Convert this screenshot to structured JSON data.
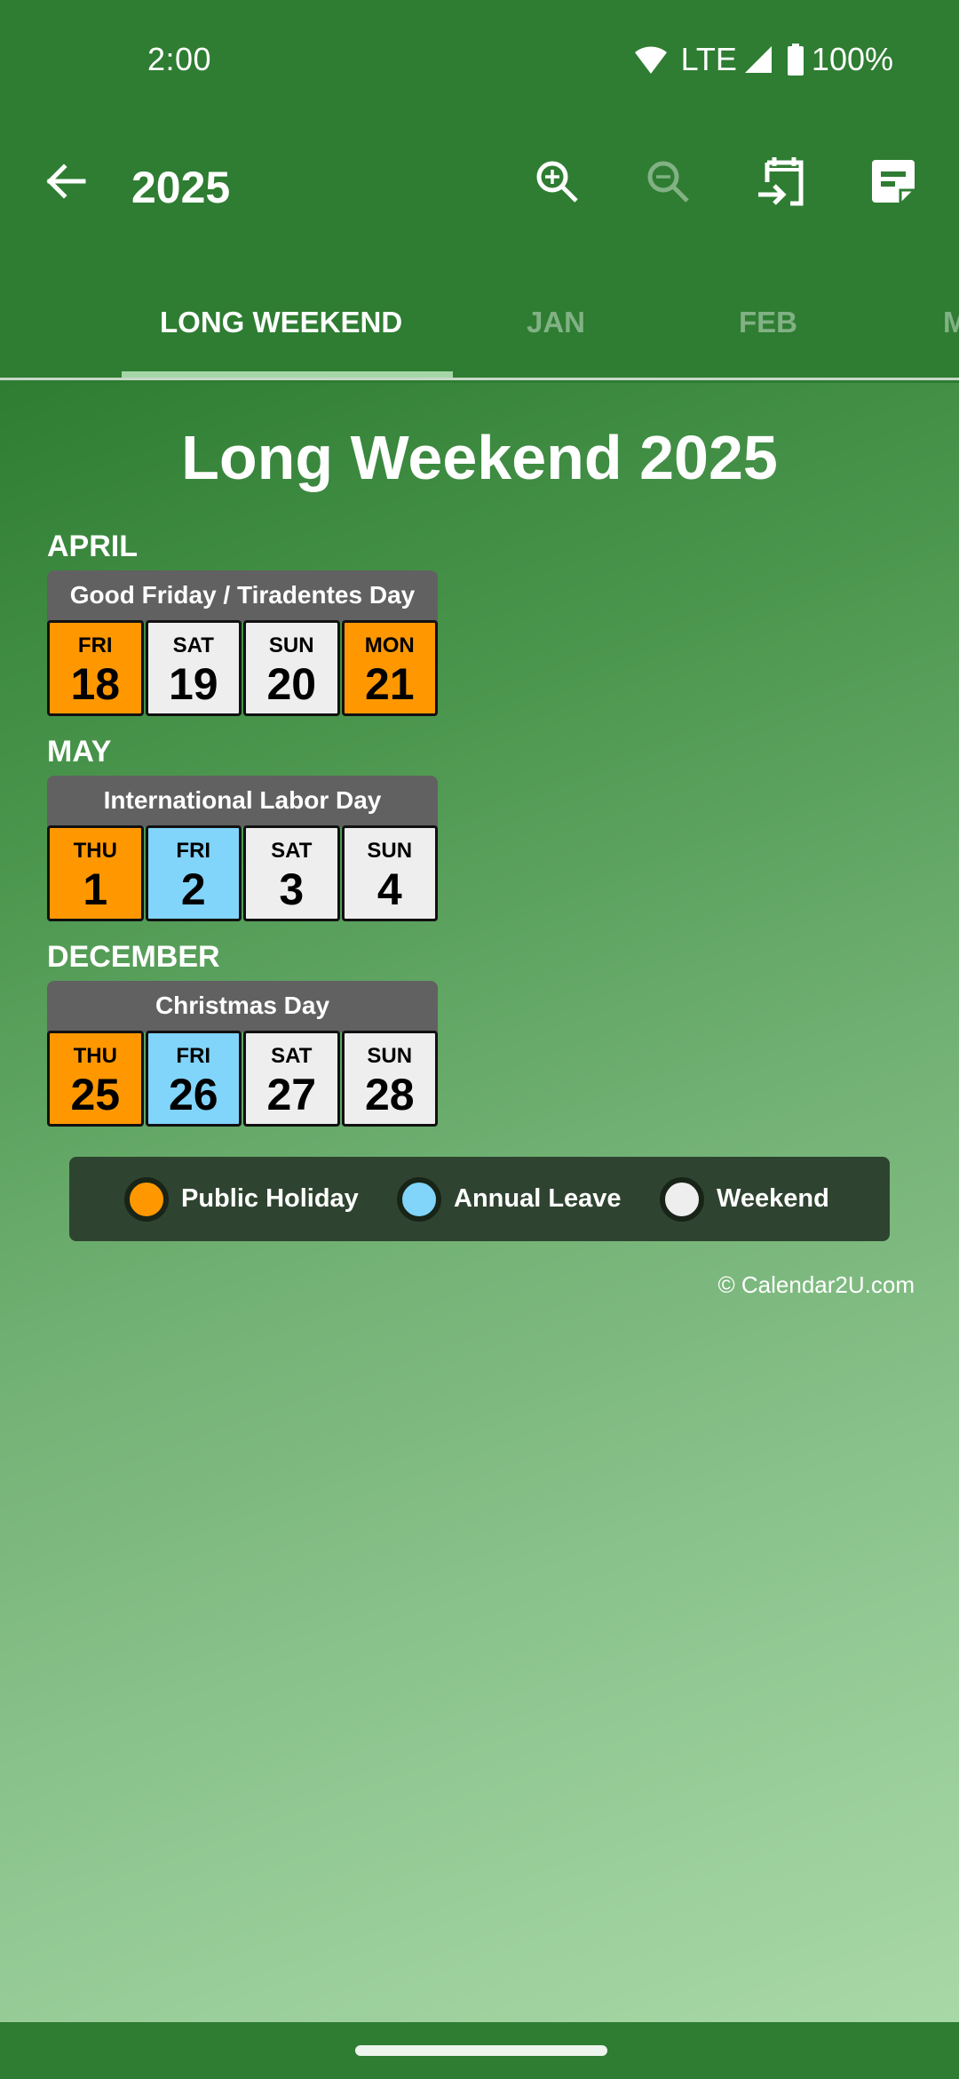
{
  "status_bar": {
    "time": "2:00",
    "network": "LTE",
    "battery": "100%",
    "icons": [
      "wifi-icon",
      "signal-icon",
      "battery-icon"
    ]
  },
  "app_bar": {
    "title": "2025",
    "back_icon": "arrow-left-icon",
    "actions": [
      {
        "name": "zoom-in",
        "icon": "zoom-in-icon",
        "enabled": true
      },
      {
        "name": "zoom-out",
        "icon": "zoom-out-icon",
        "enabled": false
      },
      {
        "name": "go-to-date",
        "icon": "calendar-arrow-icon",
        "enabled": true
      },
      {
        "name": "notes",
        "icon": "note-icon",
        "enabled": true
      }
    ]
  },
  "tabs": [
    {
      "label": "LONG WEEKEND",
      "active": true
    },
    {
      "label": "JAN",
      "active": false
    },
    {
      "label": "FEB",
      "active": false
    },
    {
      "label": "M",
      "active": false
    }
  ],
  "page": {
    "title": "Long Weekend 2025",
    "sections": [
      {
        "month": "APRIL",
        "holiday": "Good Friday / Tiradentes Day",
        "days": [
          {
            "dow": "FRI",
            "date": "18",
            "type": "public_holiday"
          },
          {
            "dow": "SAT",
            "date": "19",
            "type": "weekend"
          },
          {
            "dow": "SUN",
            "date": "20",
            "type": "weekend"
          },
          {
            "dow": "MON",
            "date": "21",
            "type": "public_holiday"
          }
        ]
      },
      {
        "month": "MAY",
        "holiday": "International Labor Day",
        "days": [
          {
            "dow": "THU",
            "date": "1",
            "type": "public_holiday"
          },
          {
            "dow": "FRI",
            "date": "2",
            "type": "annual_leave"
          },
          {
            "dow": "SAT",
            "date": "3",
            "type": "weekend"
          },
          {
            "dow": "SUN",
            "date": "4",
            "type": "weekend"
          }
        ]
      },
      {
        "month": "DECEMBER",
        "holiday": "Christmas Day",
        "days": [
          {
            "dow": "THU",
            "date": "25",
            "type": "public_holiday"
          },
          {
            "dow": "FRI",
            "date": "26",
            "type": "annual_leave"
          },
          {
            "dow": "SAT",
            "date": "27",
            "type": "weekend"
          },
          {
            "dow": "SUN",
            "date": "28",
            "type": "weekend"
          }
        ]
      }
    ],
    "legend": [
      {
        "label": "Public Holiday",
        "color": "#ff9800"
      },
      {
        "label": "Annual Leave",
        "color": "#81d4fa"
      },
      {
        "label": "Weekend",
        "color": "#eeeeee"
      }
    ],
    "copyright": "© Calendar2U.com"
  },
  "colors": {
    "primary": "#2e7d32",
    "tab_indicator": "#a5d6a7",
    "public_holiday": "#ff9800",
    "annual_leave": "#81d4fa",
    "weekend": "#eeeeee",
    "holiday_header": "#616161"
  }
}
